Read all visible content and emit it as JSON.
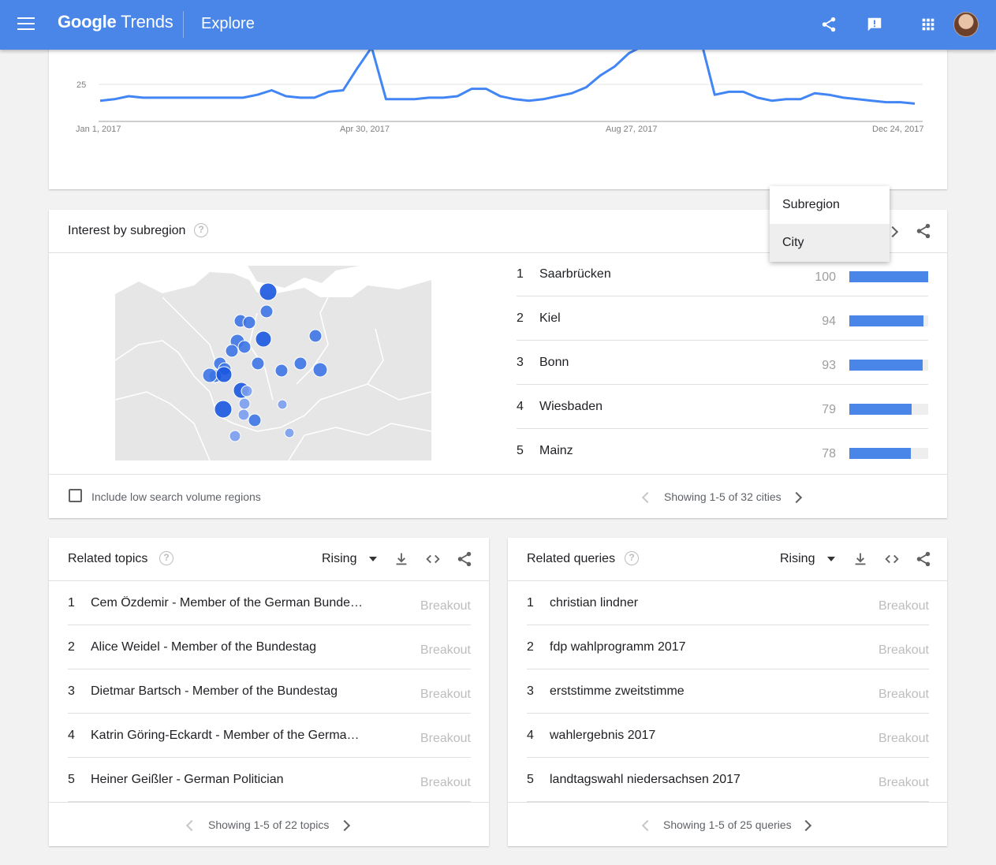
{
  "header": {
    "logo_brand": "Google",
    "logo_product": "Trends",
    "page": "Explore"
  },
  "interest_over_time": {
    "chart_data": {
      "type": "line",
      "ytick_visible": "25",
      "x_ticks": [
        "Jan 1, 2017",
        "Apr 30, 2017",
        "Aug 27, 2017",
        "Dec 24, 2017"
      ],
      "series_color": "#4285f4",
      "values": [
        14,
        15,
        17,
        16,
        16,
        16,
        16,
        16,
        16,
        16,
        16,
        18,
        21,
        17,
        16,
        16,
        20,
        21,
        36,
        50,
        15,
        15,
        15,
        16,
        16,
        17,
        22,
        22,
        17,
        15,
        14,
        15,
        17,
        19,
        23,
        31,
        37,
        46,
        51,
        56,
        57,
        57,
        56,
        18,
        20,
        20,
        16,
        14,
        15,
        15,
        19,
        18,
        16,
        15,
        14,
        13,
        13,
        12
      ]
    }
  },
  "subregion": {
    "title": "Interest by subregion",
    "help": "?",
    "rows": [
      {
        "rank": "1",
        "name": "Saarbrücken",
        "value": "100",
        "pct": 100
      },
      {
        "rank": "2",
        "name": "Kiel",
        "value": "94",
        "pct": 94
      },
      {
        "rank": "3",
        "name": "Bonn",
        "value": "93",
        "pct": 93
      },
      {
        "rank": "4",
        "name": "Wiesbaden",
        "value": "79",
        "pct": 79
      },
      {
        "rank": "5",
        "name": "Mainz",
        "value": "78",
        "pct": 78
      }
    ],
    "low_volume_label": "Include low search volume regions",
    "pager": "Showing 1-5 of 32 cities",
    "dropdown": [
      "Subregion",
      "City"
    ]
  },
  "related_topics": {
    "title": "Related topics",
    "help": "?",
    "filter": "Rising",
    "rows": [
      {
        "rank": "1",
        "text": "Cem Özdemir - Member of the German Bunde…",
        "value": "Breakout"
      },
      {
        "rank": "2",
        "text": "Alice Weidel - Member of the Bundestag",
        "value": "Breakout"
      },
      {
        "rank": "3",
        "text": "Dietmar Bartsch - Member of the Bundestag",
        "value": "Breakout"
      },
      {
        "rank": "4",
        "text": "Katrin Göring-Eckardt - Member of the Germa…",
        "value": "Breakout"
      },
      {
        "rank": "5",
        "text": "Heiner Geißler - German Politician",
        "value": "Breakout"
      }
    ],
    "pager": "Showing 1-5 of 22 topics"
  },
  "related_queries": {
    "title": "Related queries",
    "help": "?",
    "filter": "Rising",
    "rows": [
      {
        "rank": "1",
        "text": "christian lindner",
        "value": "Breakout"
      },
      {
        "rank": "2",
        "text": "fdp wahlprogramm 2017",
        "value": "Breakout"
      },
      {
        "rank": "3",
        "text": "erststimme zweitstimme",
        "value": "Breakout"
      },
      {
        "rank": "4",
        "text": "wahlergebnis 2017",
        "value": "Breakout"
      },
      {
        "rank": "5",
        "text": "landtagswahl niedersachsen 2017",
        "value": "Breakout"
      }
    ],
    "pager": "Showing 1-5 of 25 queries"
  },
  "colors": {
    "header": "#4a86e8",
    "accent": "#4285f4"
  }
}
